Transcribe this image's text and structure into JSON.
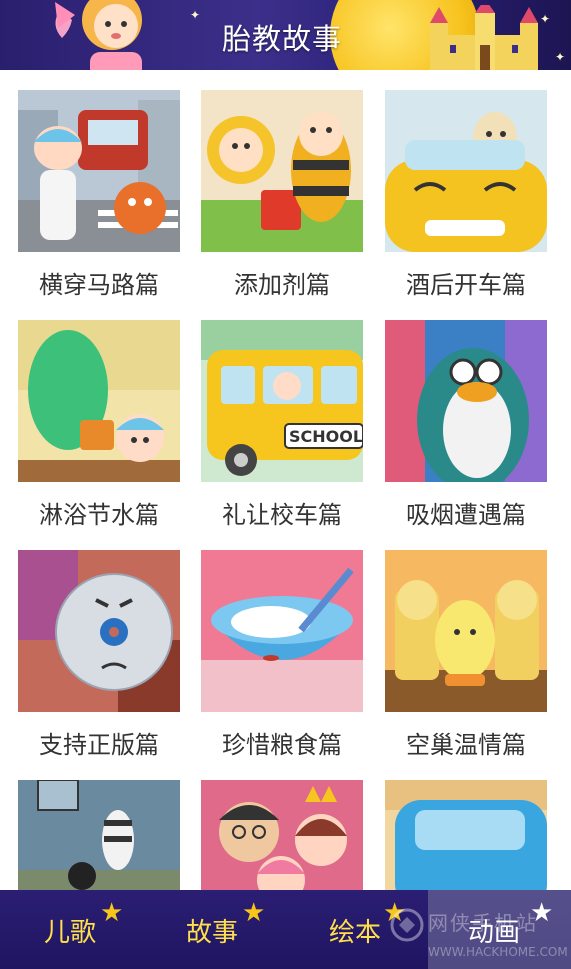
{
  "header": {
    "title": "胎教故事"
  },
  "stories": [
    {
      "title": "横穿马路篇",
      "icon": "crossing-road-thumbnail"
    },
    {
      "title": "添加剂篇",
      "icon": "additive-thumbnail"
    },
    {
      "title": "酒后开车篇",
      "icon": "drunk-driving-thumbnail"
    },
    {
      "title": "淋浴节水篇",
      "icon": "save-water-thumbnail"
    },
    {
      "title": "礼让校车篇",
      "icon": "school-bus-thumbnail"
    },
    {
      "title": "吸烟遭遇篇",
      "icon": "smoking-thumbnail"
    },
    {
      "title": "支持正版篇",
      "icon": "genuine-cd-thumbnail"
    },
    {
      "title": "珍惜粮食篇",
      "icon": "rice-bowl-thumbnail"
    },
    {
      "title": "空巢温情篇",
      "icon": "empty-nest-thumbnail"
    },
    {
      "title": "",
      "icon": "zebra-thumbnail"
    },
    {
      "title": "",
      "icon": "family-thumbnail"
    },
    {
      "title": "",
      "icon": "blue-car-thumbnail"
    }
  ],
  "nav": {
    "items": [
      {
        "label": "儿歌"
      },
      {
        "label": "故事"
      },
      {
        "label": "绘本"
      },
      {
        "label": "动画"
      }
    ],
    "active": "动画"
  },
  "watermark": {
    "text": "网侠手机站",
    "url": "WWW.HACKHOME.COM"
  },
  "colors": {
    "header_bg": "#2a1f6e",
    "nav_bg": "#231867",
    "nav_label": "#ffe04a",
    "caption": "#333333"
  }
}
